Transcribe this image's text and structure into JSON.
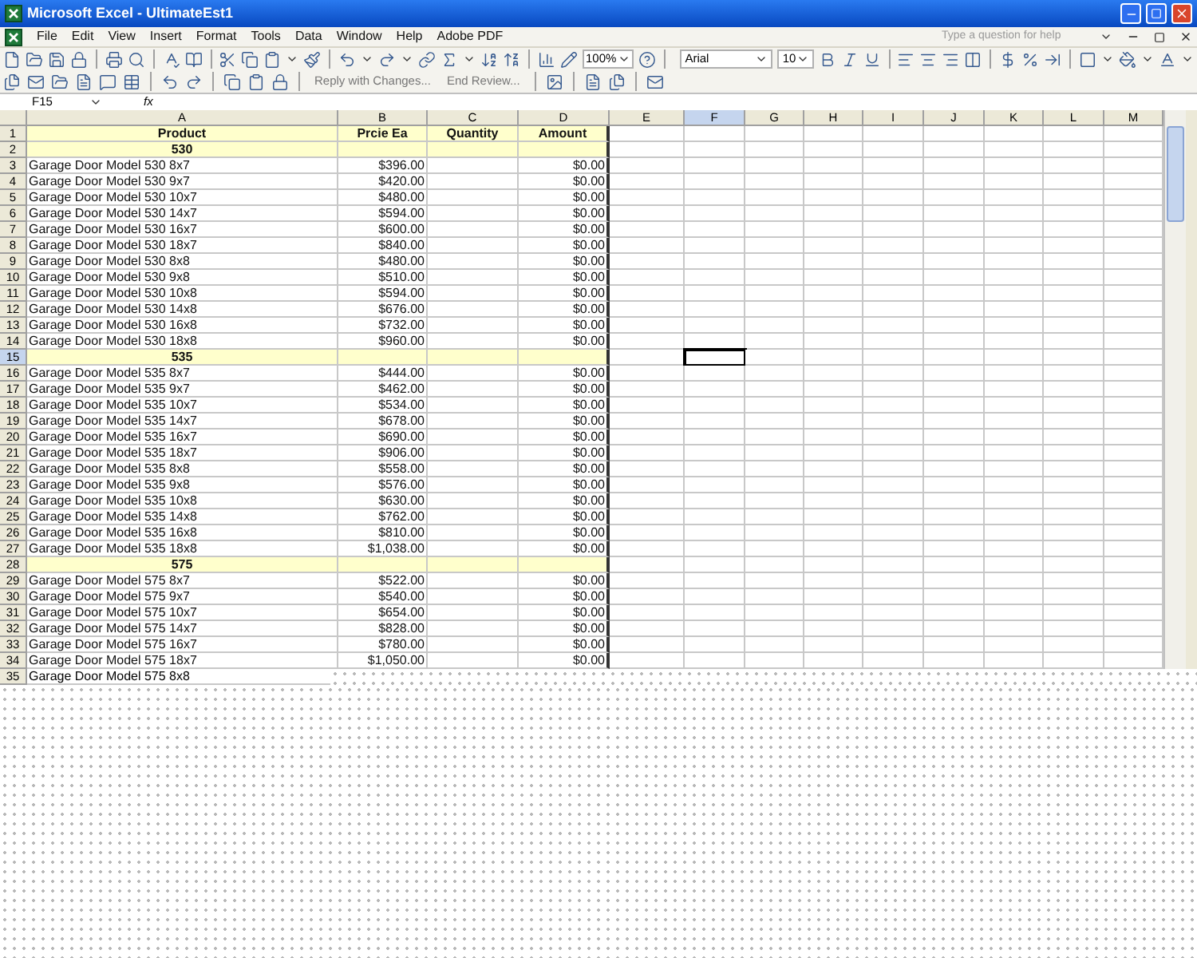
{
  "window": {
    "title": "Microsoft Excel - UltimateEst1"
  },
  "menu": [
    "File",
    "Edit",
    "View",
    "Insert",
    "Format",
    "Tools",
    "Data",
    "Window",
    "Help",
    "Adobe PDF"
  ],
  "help_box": {
    "placeholder": "Type a question for help"
  },
  "standard_toolbar": {
    "zoom": "100%"
  },
  "formatting_toolbar": {
    "font": "Arial",
    "size": "10"
  },
  "reviewing_toolbar": {
    "buttons": [
      "Reply with Changes...",
      "End Review..."
    ]
  },
  "formula_bar": {
    "name_box": "F15",
    "fx": "fx"
  },
  "columns": [
    {
      "label": "A",
      "selected": false
    },
    {
      "label": "B",
      "selected": false
    },
    {
      "label": "C",
      "selected": false
    },
    {
      "label": "D",
      "selected": false
    },
    {
      "label": "E",
      "selected": false
    },
    {
      "label": "F",
      "selected": true
    },
    {
      "label": "G",
      "selected": false
    },
    {
      "label": "H",
      "selected": false
    },
    {
      "label": "I",
      "selected": false
    },
    {
      "label": "J",
      "selected": false
    },
    {
      "label": "K",
      "selected": false
    },
    {
      "label": "L",
      "selected": false
    },
    {
      "label": "M",
      "selected": false
    }
  ],
  "rows": [
    {
      "number": "1",
      "kind": "header",
      "selected": false,
      "cells": [
        "Product",
        "Prcie Ea",
        "Quantity",
        "Amount"
      ]
    },
    {
      "number": "2",
      "kind": "group",
      "selected": false,
      "label": "530"
    },
    {
      "number": "3",
      "kind": "item",
      "selected": false,
      "product": "Garage Door Model 530 8x7",
      "price": "$396.00",
      "amount": "$0.00"
    },
    {
      "number": "4",
      "kind": "item",
      "selected": false,
      "product": "Garage Door Model 530 9x7",
      "price": "$420.00",
      "amount": "$0.00"
    },
    {
      "number": "5",
      "kind": "item",
      "selected": false,
      "product": "Garage Door Model 530 10x7",
      "price": "$480.00",
      "amount": "$0.00"
    },
    {
      "number": "6",
      "kind": "item",
      "selected": false,
      "product": "Garage Door Model 530 14x7",
      "price": "$594.00",
      "amount": "$0.00"
    },
    {
      "number": "7",
      "kind": "item",
      "selected": false,
      "product": "Garage Door Model 530 16x7",
      "price": "$600.00",
      "amount": "$0.00"
    },
    {
      "number": "8",
      "kind": "item",
      "selected": false,
      "product": "Garage Door Model 530 18x7",
      "price": "$840.00",
      "amount": "$0.00"
    },
    {
      "number": "9",
      "kind": "item",
      "selected": false,
      "product": "Garage Door Model 530 8x8",
      "price": "$480.00",
      "amount": "$0.00"
    },
    {
      "number": "10",
      "kind": "item",
      "selected": false,
      "product": "Garage Door Model 530 9x8",
      "price": "$510.00",
      "amount": "$0.00"
    },
    {
      "number": "11",
      "kind": "item",
      "selected": false,
      "product": "Garage Door Model 530 10x8",
      "price": "$594.00",
      "amount": "$0.00"
    },
    {
      "number": "12",
      "kind": "item",
      "selected": false,
      "product": "Garage Door Model 530 14x8",
      "price": "$676.00",
      "amount": "$0.00"
    },
    {
      "number": "13",
      "kind": "item",
      "selected": false,
      "product": "Garage Door Model 530 16x8",
      "price": "$732.00",
      "amount": "$0.00"
    },
    {
      "number": "14",
      "kind": "item",
      "selected": false,
      "product": "Garage Door Model 530 18x8",
      "price": "$960.00",
      "amount": "$0.00"
    },
    {
      "number": "15",
      "kind": "group",
      "selected": true,
      "label": "535"
    },
    {
      "number": "16",
      "kind": "item",
      "selected": false,
      "product": "Garage Door Model 535 8x7",
      "price": "$444.00",
      "amount": "$0.00"
    },
    {
      "number": "17",
      "kind": "item",
      "selected": false,
      "product": "Garage Door Model 535 9x7",
      "price": "$462.00",
      "amount": "$0.00"
    },
    {
      "number": "18",
      "kind": "item",
      "selected": false,
      "product": "Garage Door Model 535 10x7",
      "price": "$534.00",
      "amount": "$0.00"
    },
    {
      "number": "19",
      "kind": "item",
      "selected": false,
      "product": "Garage Door Model 535 14x7",
      "price": "$678.00",
      "amount": "$0.00"
    },
    {
      "number": "20",
      "kind": "item",
      "selected": false,
      "product": "Garage Door Model 535 16x7",
      "price": "$690.00",
      "amount": "$0.00"
    },
    {
      "number": "21",
      "kind": "item",
      "selected": false,
      "product": "Garage Door Model 535 18x7",
      "price": "$906.00",
      "amount": "$0.00"
    },
    {
      "number": "22",
      "kind": "item",
      "selected": false,
      "product": "Garage Door Model 535 8x8",
      "price": "$558.00",
      "amount": "$0.00"
    },
    {
      "number": "23",
      "kind": "item",
      "selected": false,
      "product": "Garage Door Model 535 9x8",
      "price": "$576.00",
      "amount": "$0.00"
    },
    {
      "number": "24",
      "kind": "item",
      "selected": false,
      "product": "Garage Door Model 535 10x8",
      "price": "$630.00",
      "amount": "$0.00"
    },
    {
      "number": "25",
      "kind": "item",
      "selected": false,
      "product": "Garage Door Model 535 14x8",
      "price": "$762.00",
      "amount": "$0.00"
    },
    {
      "number": "26",
      "kind": "item",
      "selected": false,
      "product": "Garage Door Model 535 16x8",
      "price": "$810.00",
      "amount": "$0.00"
    },
    {
      "number": "27",
      "kind": "item",
      "selected": false,
      "product": "Garage Door Model 535 18x8",
      "price": "$1,038.00",
      "amount": "$0.00"
    },
    {
      "number": "28",
      "kind": "group",
      "selected": false,
      "label": "575"
    },
    {
      "number": "29",
      "kind": "item",
      "selected": false,
      "product": "Garage Door Model 575 8x7",
      "price": "$522.00",
      "amount": "$0.00"
    },
    {
      "number": "30",
      "kind": "item",
      "selected": false,
      "product": "Garage Door Model 575 9x7",
      "price": "$540.00",
      "amount": "$0.00"
    },
    {
      "number": "31",
      "kind": "item",
      "selected": false,
      "product": "Garage Door Model 575 10x7",
      "price": "$654.00",
      "amount": "$0.00"
    },
    {
      "number": "32",
      "kind": "item",
      "selected": false,
      "product": "Garage Door Model 575 14x7",
      "price": "$828.00",
      "amount": "$0.00"
    },
    {
      "number": "33",
      "kind": "item",
      "selected": false,
      "product": "Garage Door Model 575 16x7",
      "price": "$780.00",
      "amount": "$0.00"
    },
    {
      "number": "34",
      "kind": "item",
      "selected": false,
      "product": "Garage Door Model 575 18x7",
      "price": "$1,050.00",
      "amount": "$0.00"
    }
  ],
  "partial_row": {
    "number": "35",
    "product": "Garage Door Model 575 8x8"
  }
}
